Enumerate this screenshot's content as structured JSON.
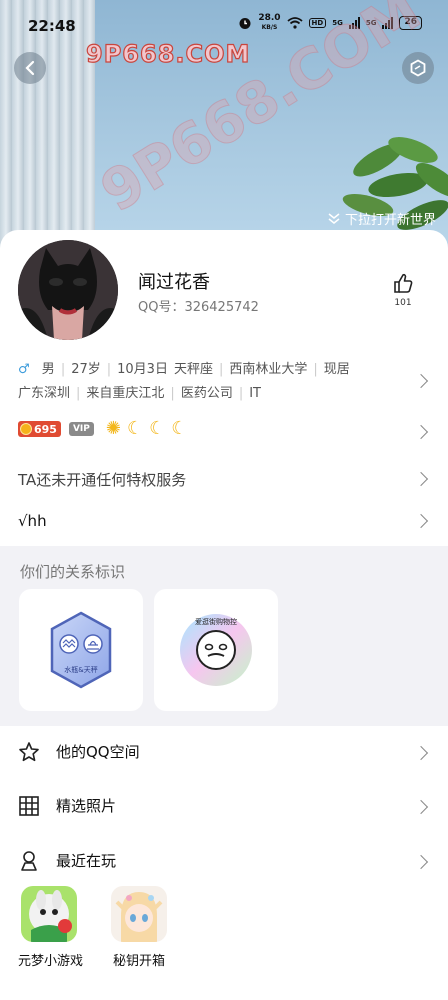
{
  "status_bar": {
    "time": "22:48",
    "net_speed_value": "28.0",
    "net_speed_unit": "KB/S",
    "hd_label": "HD",
    "sim1": "5G",
    "sim2": "5G",
    "battery": "26"
  },
  "header": {
    "watermark_top": "9P668.COM",
    "watermark_diag": "9P668.COM",
    "pull_hint": "下拉打开新世界"
  },
  "profile": {
    "nickname": "闻过花香",
    "qq_number": "QQ号：326425742",
    "like_count": "101"
  },
  "info": {
    "gender_symbol": "♂",
    "items_line1": [
      "男",
      "27岁",
      "10月3日",
      "天秤座",
      "西南林业大学",
      "现居"
    ],
    "items_line2": [
      "广东深圳",
      "来自重庆江北",
      "医药公司",
      "IT"
    ]
  },
  "badges": {
    "score": "695",
    "vip_label": "VIP",
    "level_icons": [
      "sun-icon",
      "moon-icon",
      "moon-icon",
      "moon-icon"
    ]
  },
  "privilege_text": "TA还未开通任何特权服务",
  "signature": "√hh",
  "relationship": {
    "title": "你们的关系标识",
    "card1_label": "水瓶&天秤",
    "card2_label": "爱逛街购物控"
  },
  "menu": {
    "qzone": "他的QQ空间",
    "photos": "精选照片",
    "recent": "最近在玩"
  },
  "apps": [
    {
      "label": "元梦小游戏"
    },
    {
      "label": "秘钥开箱"
    }
  ],
  "colors": {
    "accent_red": "#e04b32",
    "male_blue": "#3b9bdb",
    "vip_gray": "#8a8a8a"
  }
}
